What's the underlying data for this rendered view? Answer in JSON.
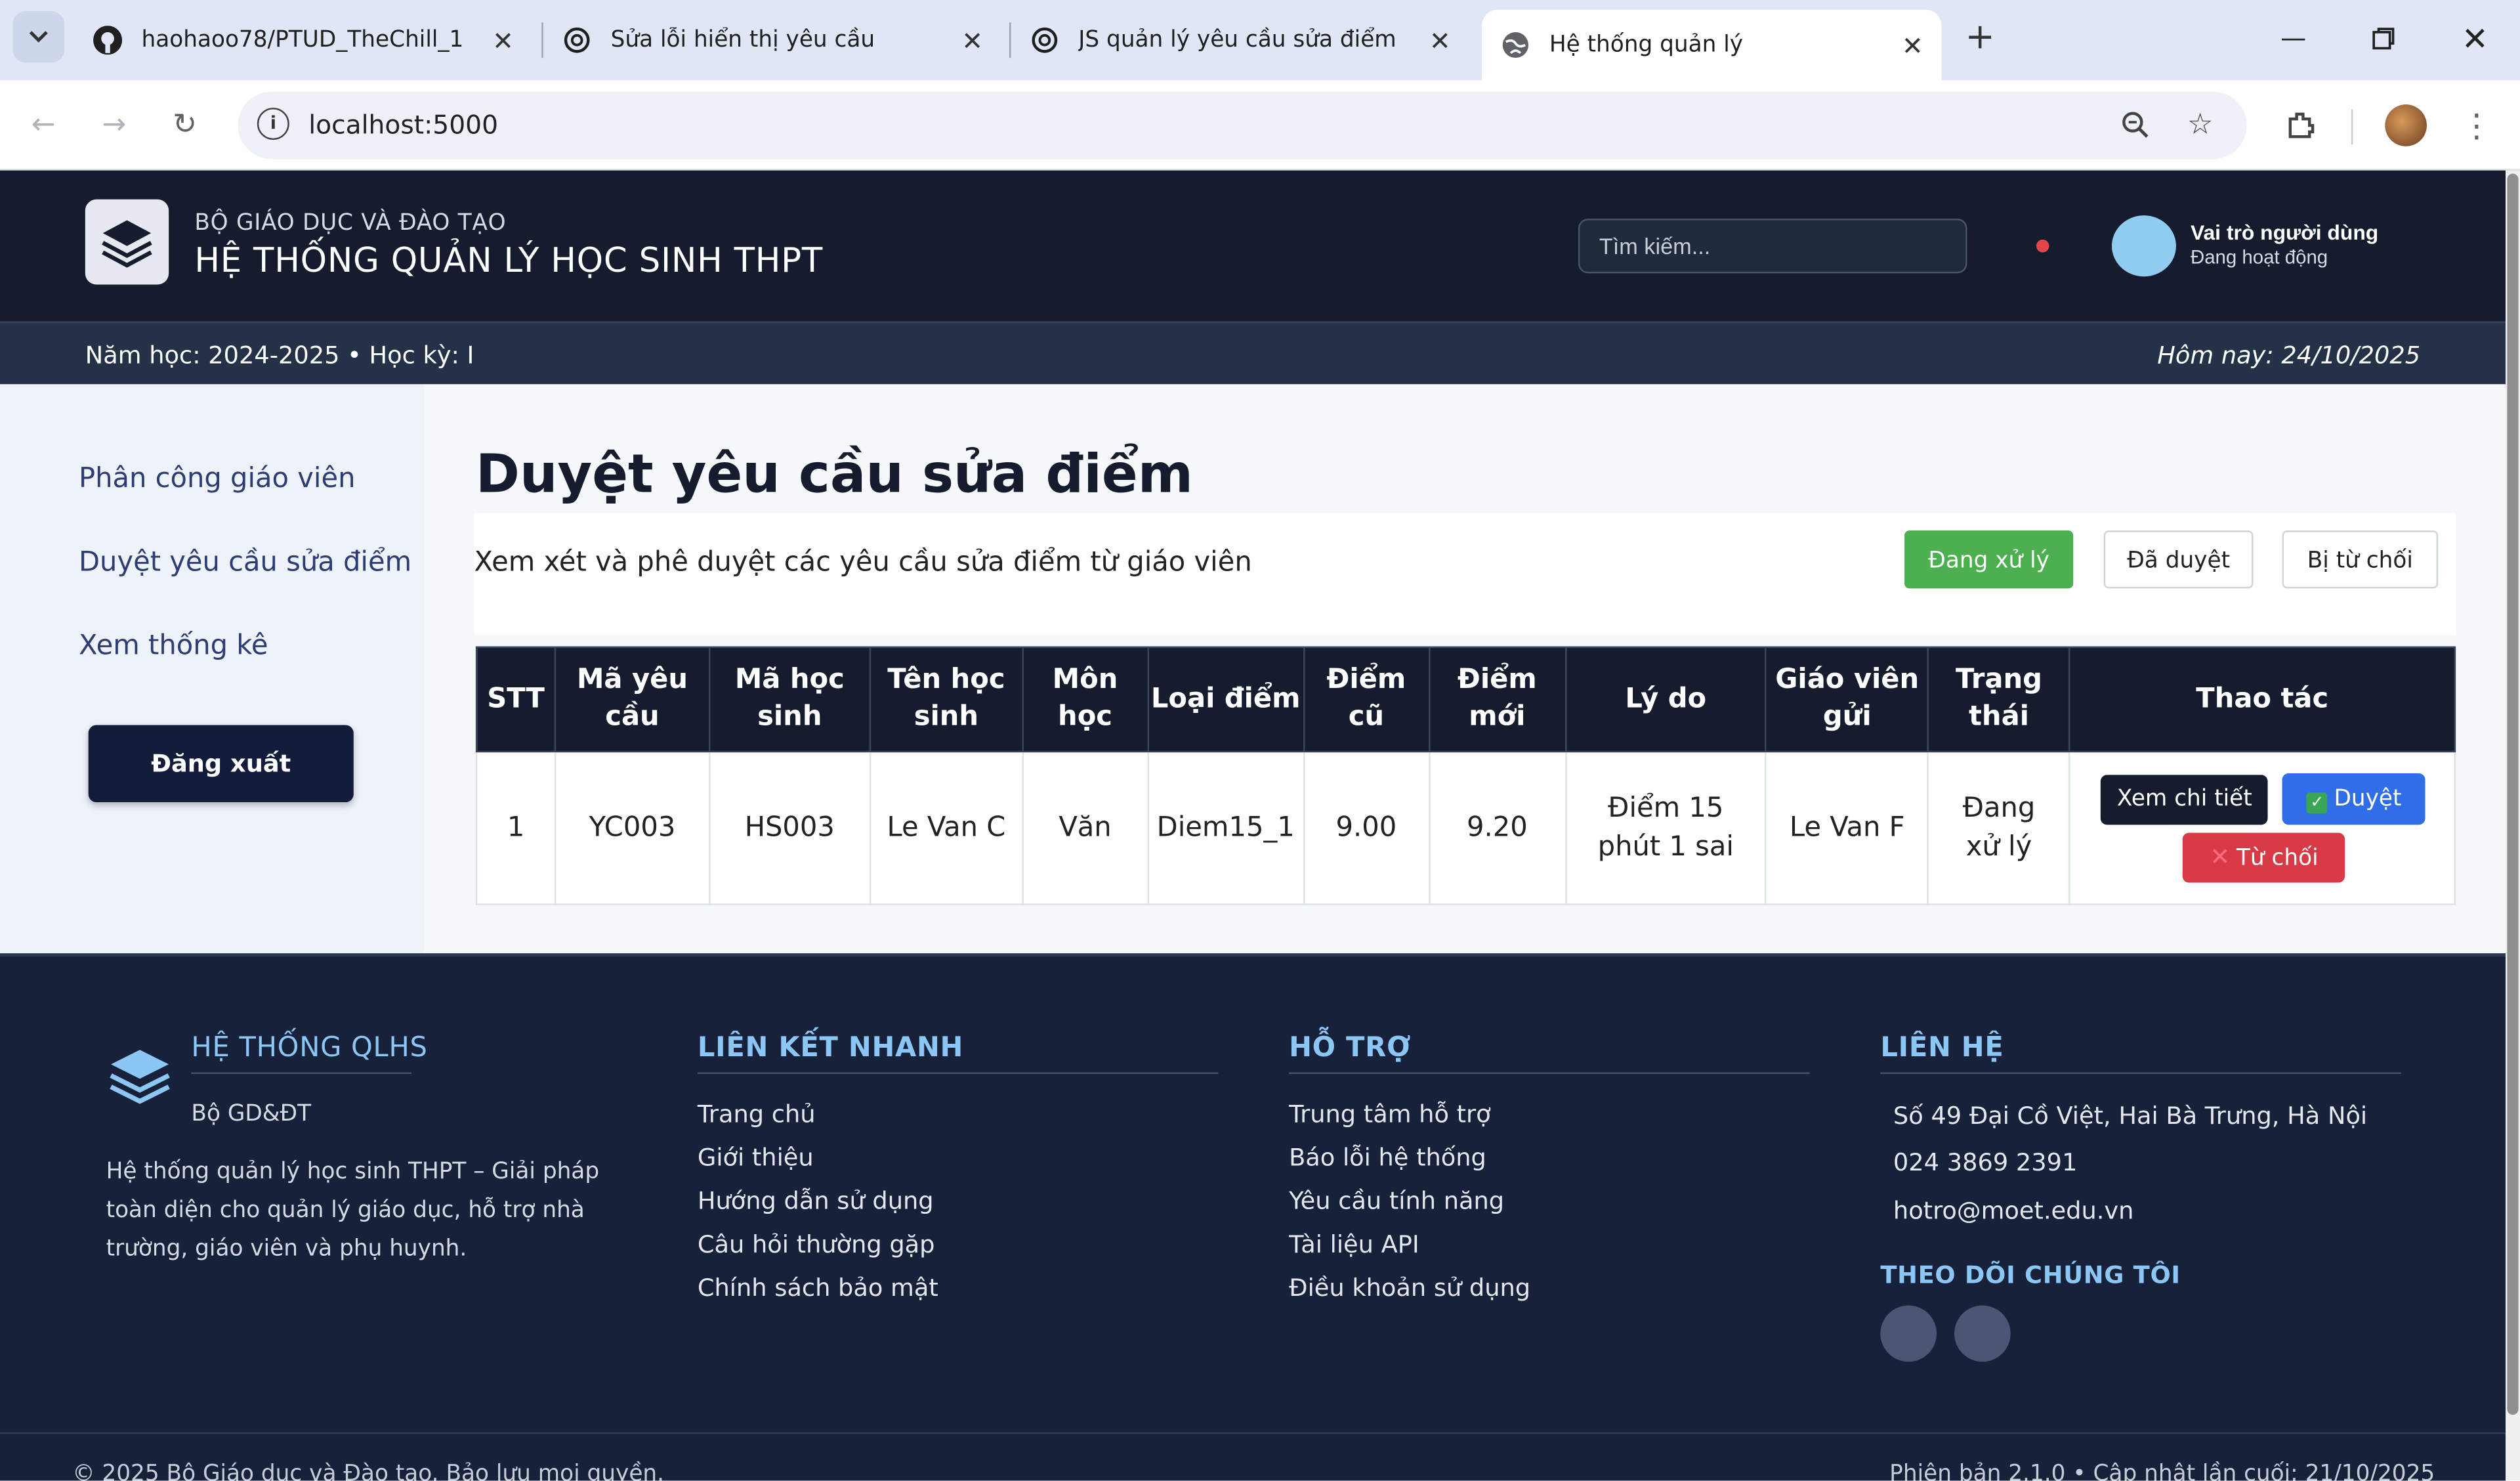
{
  "browser": {
    "tabs": [
      {
        "title": "haohaoo78/PTUD_TheChill_1",
        "icon": "github-icon"
      },
      {
        "title": "Sửa lỗi hiển thị yêu cầu",
        "icon": "openai-icon"
      },
      {
        "title": "JS quản lý yêu cầu sửa điểm",
        "icon": "openai-icon"
      },
      {
        "title": "Hệ thống quản lý",
        "icon": "globe-icon"
      }
    ],
    "url": "localhost:5000"
  },
  "header": {
    "org": "BỘ GIÁO DỤC VÀ ĐÀO TẠO",
    "system": "HỆ THỐNG QUẢN LÝ HỌC SINH THPT",
    "search_placeholder": "Tìm kiếm...",
    "user_role": "Vai trò người dùng",
    "user_status": "Đang hoạt động",
    "notif_color": "#e2464a"
  },
  "subbar": {
    "term": "Năm học: 2024-2025 • Học kỳ: I",
    "today": "Hôm nay: 24/10/2025"
  },
  "sidebar": {
    "items": [
      {
        "label": "Phân công giáo viên"
      },
      {
        "label": "Duyệt yêu cầu sửa điểm"
      },
      {
        "label": "Xem thống kê"
      }
    ],
    "logout": "Đăng xuất"
  },
  "main": {
    "title": "Duyệt yêu cầu sửa điểm",
    "description": "Xem xét và phê duyệt các yêu cầu sửa điểm từ giáo viên",
    "filters": [
      {
        "label": "Đang xử lý",
        "active": true
      },
      {
        "label": "Đã duyệt",
        "active": false
      },
      {
        "label": "Bị từ chối",
        "active": false
      }
    ],
    "table": {
      "headers": [
        "STT",
        "Mã yêu cầu",
        "Mã học sinh",
        "Tên học sinh",
        "Môn học",
        "Loại điểm",
        "Điểm cũ",
        "Điểm mới",
        "Lý do",
        "Giáo viên gửi",
        "Trạng thái",
        "Thao tác"
      ],
      "rows": [
        {
          "stt": "1",
          "request_id": "YC003",
          "student_id": "HS003",
          "student_name": "Le Van C",
          "subject": "Văn",
          "score_type": "Diem15_1",
          "old_score": "9.00",
          "new_score": "9.20",
          "reason": "Điểm 15 phút 1 sai",
          "teacher": "Le Van F",
          "status": "Đang xử lý"
        }
      ],
      "actions": {
        "detail": "Xem chi tiết",
        "approve": "Duyệt",
        "reject": "Từ chối"
      }
    }
  },
  "footer": {
    "brand": "HỆ THỐNG QLHS",
    "brand_sub": "Bộ GD&ĐT",
    "description": "Hệ thống quản lý học sinh THPT – Giải pháp toàn diện cho quản lý giáo dục, hỗ trợ nhà trường, giáo viên và phụ huynh.",
    "quick_links_title": "LIÊN KẾT NHANH",
    "quick_links": [
      "Trang chủ",
      "Giới thiệu",
      "Hướng dẫn sử dụng",
      "Câu hỏi thường gặp",
      "Chính sách bảo mật"
    ],
    "support_title": "HỖ TRỢ",
    "support_links": [
      "Trung tâm hỗ trợ",
      "Báo lỗi hệ thống",
      "Yêu cầu tính năng",
      "Tài liệu API",
      "Điều khoản sử dụng"
    ],
    "contact_title": "LIÊN HỆ",
    "contact": [
      "Số 49 Đại Cồ Việt, Hai Bà Trưng, Hà Nội",
      "024 3869 2391",
      "hotro@moet.edu.vn"
    ],
    "follow_title": "THEO DÕI CHÚNG TÔI",
    "copyright": "© 2025 Bộ Giáo dục và Đào tạo. Bảo lưu mọi quyền.",
    "version": "Phiên bản 2.1.0  •  Cập nhật lần cuối: 21/10/2025"
  }
}
